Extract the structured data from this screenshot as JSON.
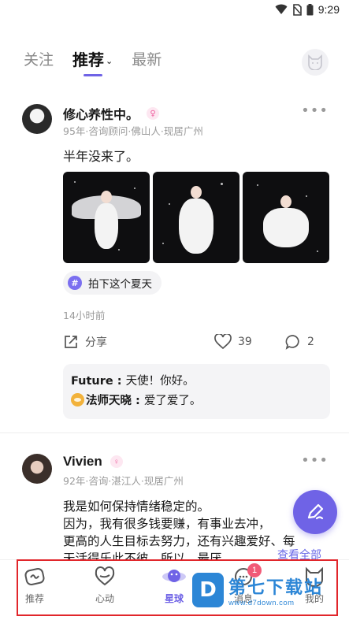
{
  "status_bar": {
    "time": "9:29"
  },
  "top_tabs": [
    {
      "label": "关注"
    },
    {
      "label": "推荐"
    },
    {
      "label": "最新"
    }
  ],
  "posts": [
    {
      "username": "修心养性中。",
      "meta": "95年·咨询顾问·佛山人·现居广州",
      "content": "半年没来了。",
      "topic": "拍下这个夏天",
      "time_ago": "14小时前",
      "share_label": "分享",
      "likes": "39",
      "comment_count": "2",
      "comments": [
        {
          "author": "Future",
          "text": "天使！你好。"
        },
        {
          "author": "法师天晓",
          "text": "爱了爱了。"
        }
      ]
    },
    {
      "username": "Vivien",
      "meta": "92年·咨询·湛江人·现居广州",
      "content_lines": [
        "我是如何保持情绪稳定的。",
        "因为，我有很多钱要赚，有事业去冲，",
        "更高的人生目标去努力，还有兴趣爱好、每",
        "天活得乐此不彼。所以，最厌"
      ],
      "see_all": "查看全部"
    }
  ],
  "bottom_nav": [
    {
      "label": "推荐"
    },
    {
      "label": "心动"
    },
    {
      "label": "星球"
    },
    {
      "label": "消息",
      "badge": "1"
    },
    {
      "label": "我的"
    }
  ],
  "watermark": {
    "main": "第七下载站",
    "url": "www.d7down.com"
  },
  "colors": {
    "accent": "#6f63e6",
    "badge": "#f15a77",
    "annotation_frame": "#e1262b"
  }
}
